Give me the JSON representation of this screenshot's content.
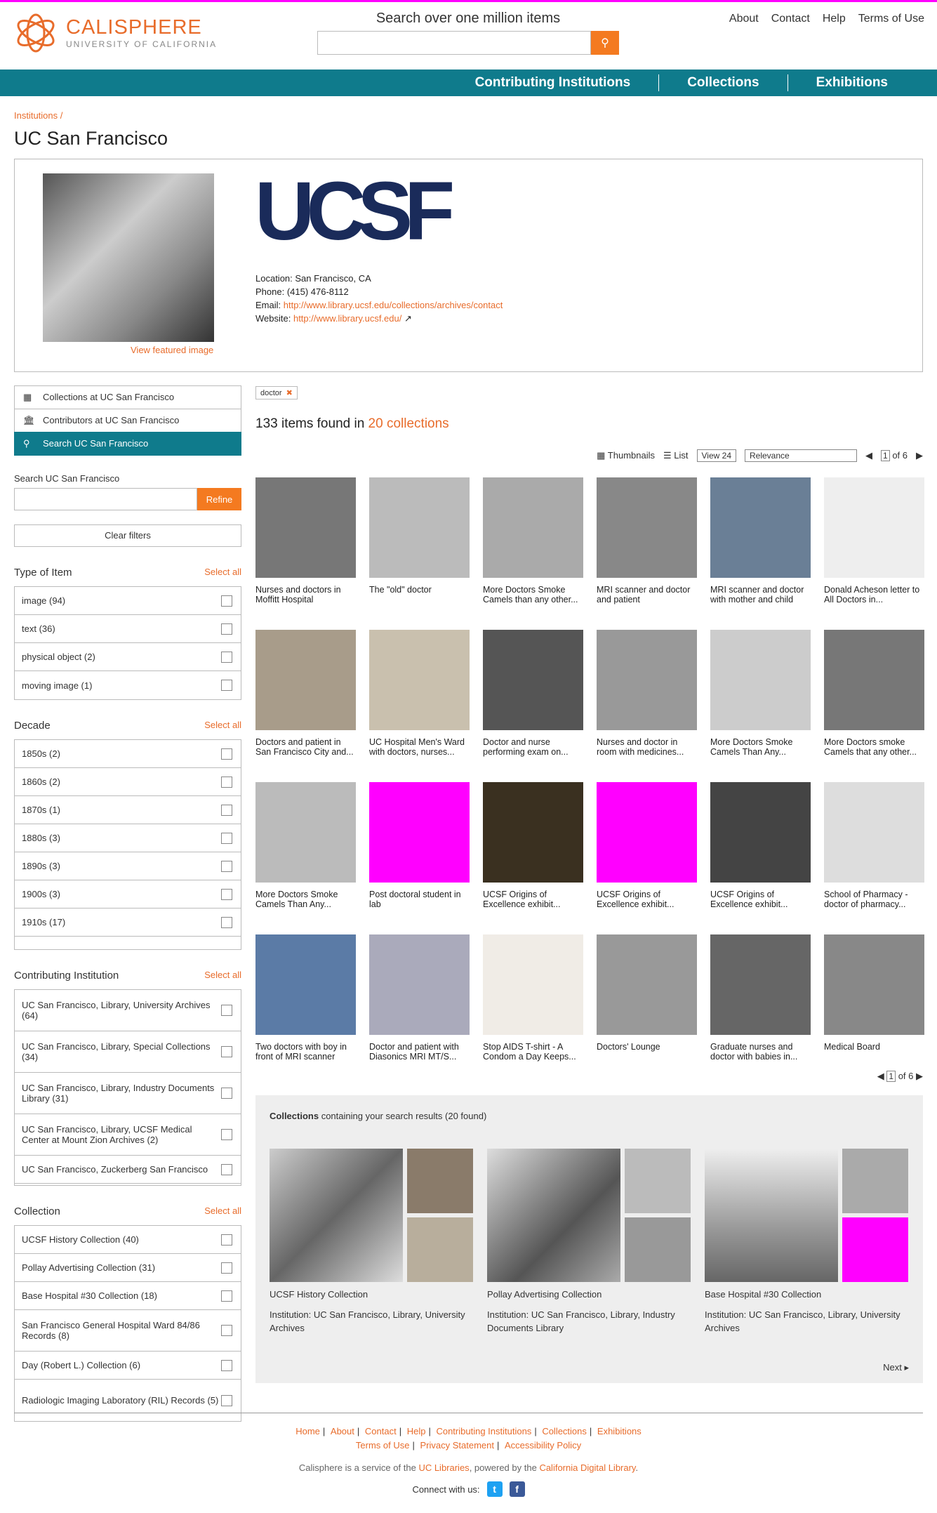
{
  "site": {
    "name": "CALISPHERE",
    "subname": "UNIVERSITY OF CALIFORNIA",
    "search_label": "Search over one million items",
    "search_placeholder": ""
  },
  "toplinks": [
    "About",
    "Contact",
    "Help",
    "Terms of Use"
  ],
  "nav": [
    "Contributing Institutions",
    "Collections",
    "Exhibitions"
  ],
  "breadcrumb": "Institutions /",
  "title": "UC San Francisco",
  "institution": {
    "logo_text": "UCSF",
    "featured_link": "View featured image",
    "location_label": "Location:",
    "location": "San Francisco, CA",
    "phone_label": "Phone:",
    "phone": "(415) 476-8112",
    "email_label": "Email:",
    "email": "http://www.library.ucsf.edu/collections/archives/contact",
    "website_label": "Website:",
    "website": "http://www.library.ucsf.edu/"
  },
  "sidenav": [
    "Collections at UC San Francisco",
    "Contributors at UC San Francisco",
    "Search UC San Francisco"
  ],
  "sidesearch": {
    "label": "Search UC San Francisco",
    "refine": "Refine",
    "clear": "Clear filters"
  },
  "facets": {
    "type": {
      "title": "Type of Item",
      "select": "Select all",
      "items": [
        "image (94)",
        "text (36)",
        "physical object (2)",
        "moving image (1)"
      ]
    },
    "decade": {
      "title": "Decade",
      "select": "Select all",
      "items": [
        "1850s (2)",
        "1860s (2)",
        "1870s (1)",
        "1880s (3)",
        "1890s (3)",
        "1900s (3)",
        "1910s (17)"
      ]
    },
    "inst": {
      "title": "Contributing Institution",
      "select": "Select all",
      "items": [
        "UC San Francisco, Library, University Archives (64)",
        "UC San Francisco, Library, Special Collections (34)",
        "UC San Francisco, Library, Industry Documents Library (31)",
        "UC San Francisco, Library, UCSF Medical Center at Mount Zion Archives (2)",
        "UC San Francisco, Zuckerberg San Francisco"
      ]
    },
    "coll": {
      "title": "Collection",
      "select": "Select all",
      "items": [
        "UCSF History Collection (40)",
        "Pollay Advertising Collection (31)",
        "Base Hospital #30 Collection (18)",
        "San Francisco General Hospital Ward 84/86 Records (8)",
        "Day (Robert L.) Collection (6)",
        "Radiologic Imaging Laboratory (RIL) Records (5)"
      ]
    }
  },
  "query": {
    "chip": "doctor",
    "chip_x": "✖"
  },
  "results": {
    "count_text": "133 items found in",
    "coll_link": "20 collections"
  },
  "toolbar": {
    "thumbs": "Thumbnails",
    "list": "List",
    "view": "View 24",
    "sort": "Relevance",
    "page": "1",
    "of": "of 6"
  },
  "items": [
    "Nurses and doctors in Moffitt Hospital",
    "The \"old\" doctor",
    "More Doctors Smoke Camels than any other...",
    "MRI scanner and doctor and patient",
    "MRI scanner and doctor with mother and child",
    "Donald Acheson letter to All Doctors in...",
    "Doctors and patient in San Francisco City and...",
    "UC Hospital Men's Ward with doctors, nurses...",
    "Doctor and nurse performing exam on...",
    "Nurses and doctor in room with medicines...",
    "More Doctors Smoke Camels Than Any...",
    "More Doctors smoke Camels that any other...",
    "More Doctors Smoke Camels Than Any...",
    "Post doctoral student in lab",
    "UCSF Origins of Excellence exhibit...",
    "UCSF Origins of Excellence exhibit...",
    "UCSF Origins of Excellence exhibit...",
    "School of Pharmacy - doctor of pharmacy...",
    "Two doctors with boy in front of MRI scanner",
    "Doctor and patient with Diasonics MRI MT/S...",
    "Stop AIDS T-shirt - A Condom a Day Keeps...",
    "Doctors' Lounge",
    "Graduate nurses and doctor with babies in...",
    "Medical Board"
  ],
  "collections": {
    "title_bold": "Collections",
    "title_rest": "containing your search results (20 found)",
    "cards": [
      {
        "name": "UCSF History Collection",
        "inst": "Institution: UC San Francisco, Library, University Archives"
      },
      {
        "name": "Pollay Advertising Collection",
        "inst": "Institution: UC San Francisco, Library, Industry Documents Library"
      },
      {
        "name": "Base Hospital #30 Collection",
        "inst": "Institution: UC San Francisco, Library, University Archives"
      }
    ],
    "next": "Next"
  },
  "footer": {
    "links1": [
      "Home",
      "About",
      "Contact",
      "Help",
      "Contributing Institutions",
      "Collections",
      "Exhibitions"
    ],
    "links2": [
      "Terms of Use",
      "Privacy Statement",
      "Accessibility Policy"
    ],
    "svc_a": "Calisphere is a service of the",
    "svc_b": "UC Libraries",
    "svc_c": ", powered by the",
    "svc_d": "California Digital Library",
    "svc_e": ".",
    "connect": "Connect with us:"
  }
}
